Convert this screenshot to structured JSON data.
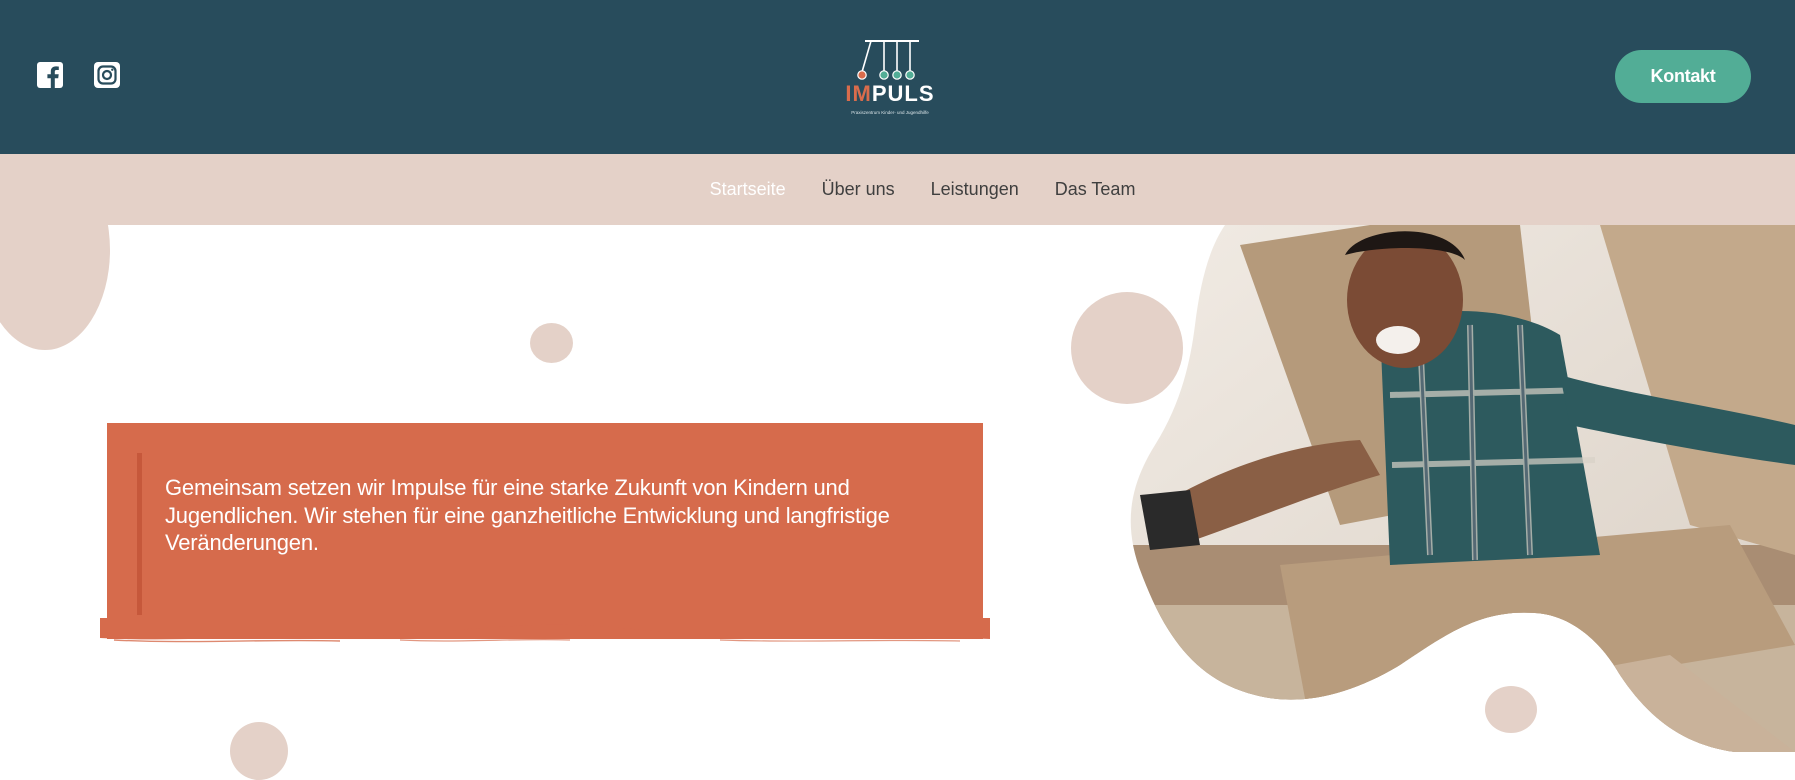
{
  "header": {
    "social": [
      {
        "name": "Facebook",
        "icon": "facebook-icon"
      },
      {
        "name": "Instagram",
        "icon": "instagram-icon"
      }
    ],
    "logo": {
      "brand_part1": "IM",
      "brand_part2": "PULS",
      "tagline": "Praxiszentrum Kinder- und Jugendhilfe",
      "colors": {
        "im": "#d96c4c",
        "puls": "#ffffff"
      }
    },
    "contact_button": "Kontakt"
  },
  "nav": {
    "items": [
      {
        "label": "Startseite",
        "active": true
      },
      {
        "label": "Über uns",
        "active": false
      },
      {
        "label": "Leistungen",
        "active": false
      },
      {
        "label": "Das Team",
        "active": false
      }
    ]
  },
  "hero": {
    "quote": "Gemeinsam setzen wir Impulse für eine starke Zukunft von Kindern und Jugendlichen. Wir stehen für eine ganzheitliche Entwicklung und langfristige Veränderungen.",
    "image_description": "Boy playing in a cardboard box"
  },
  "colors": {
    "header_bg": "#284c5c",
    "nav_bg": "#e4d1c8",
    "accent_orange": "#d66b4c",
    "accent_green": "#52ad96",
    "decor_circle": "#e4d1c8"
  }
}
